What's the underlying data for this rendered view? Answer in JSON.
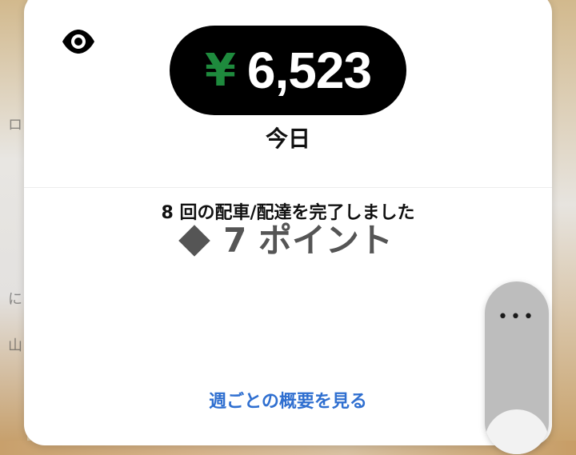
{
  "earnings": {
    "currency_symbol": "¥",
    "amount": "6,523",
    "period": "今日"
  },
  "stats": {
    "trips_completed": "8 回の配車/配達を完了しました",
    "points": "7 ポイント"
  },
  "links": {
    "weekly_summary": "週ごとの概要を見る"
  },
  "controls": {
    "more_button": "•••"
  },
  "icons": {
    "visibility": "eye-icon",
    "points_marker": "diamond-icon"
  },
  "map_labels": {
    "left_1": "ロ",
    "left_2": "に",
    "left_3": "山"
  },
  "colors": {
    "yen_green": "#1e8a3d",
    "link_blue": "#2f6fd0",
    "points_gray": "#555555"
  }
}
